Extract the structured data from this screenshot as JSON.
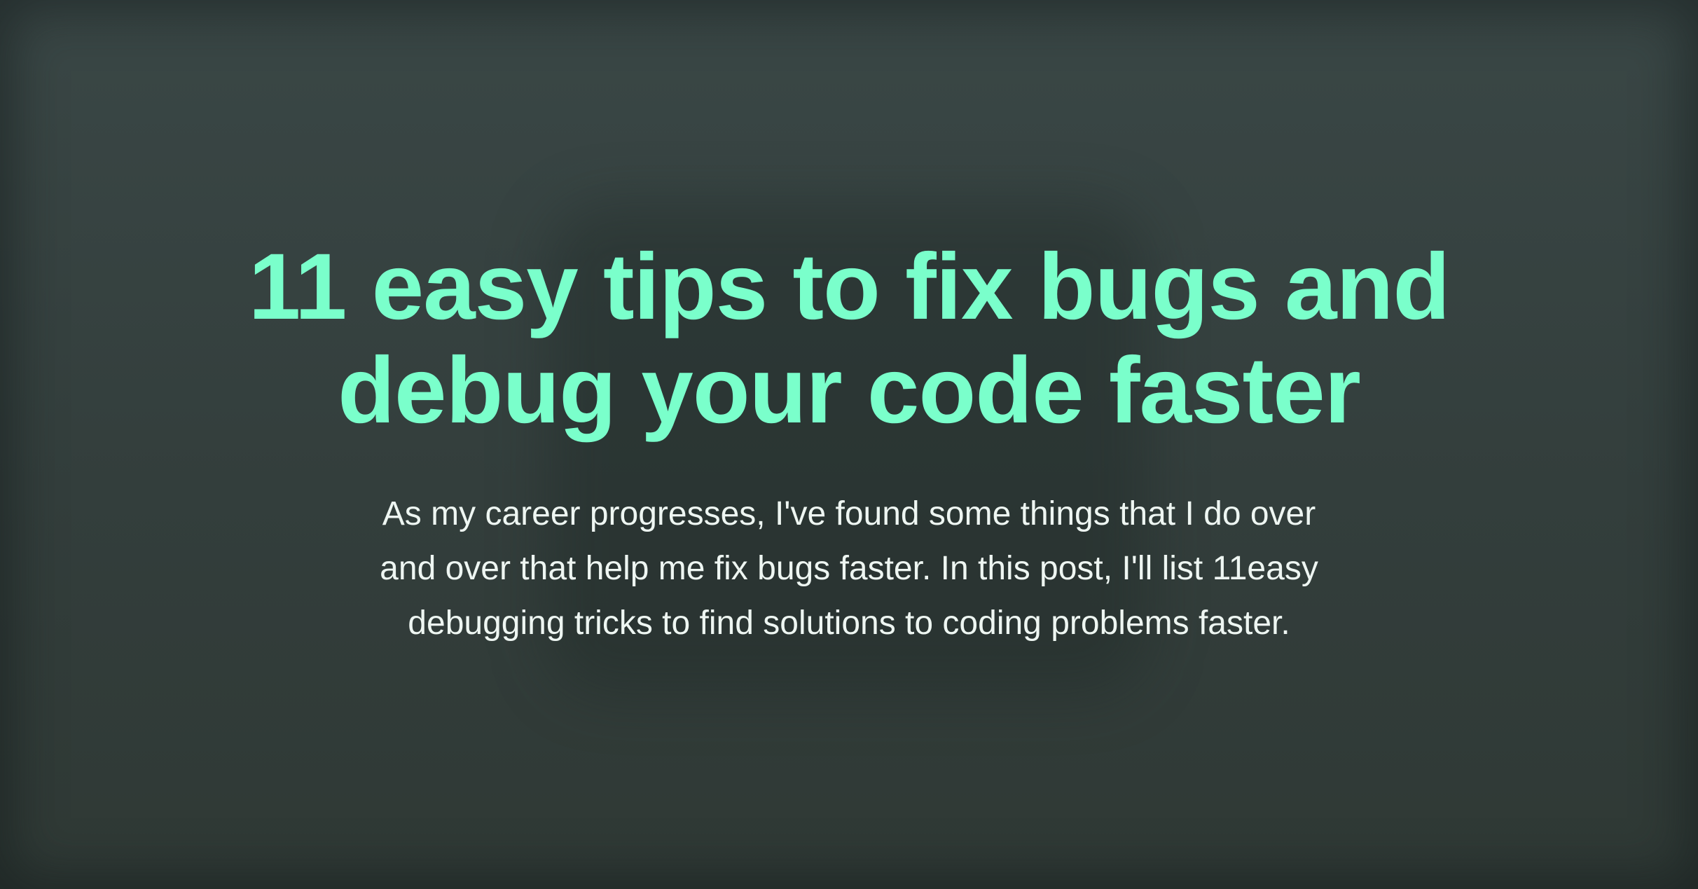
{
  "hero": {
    "title_lines": [
      "11 easy tips to fix bugs and",
      "debug your code faster"
    ],
    "description_lines": [
      "As my career progresses, I've found some things that I do over",
      "and over that help me fix bugs faster. In this post, I'll list 11easy",
      "debugging tricks to find solutions to coding problems faster."
    ]
  },
  "colors": {
    "background": "#344240",
    "title": "#7affcb",
    "description": "#eef6f2"
  }
}
